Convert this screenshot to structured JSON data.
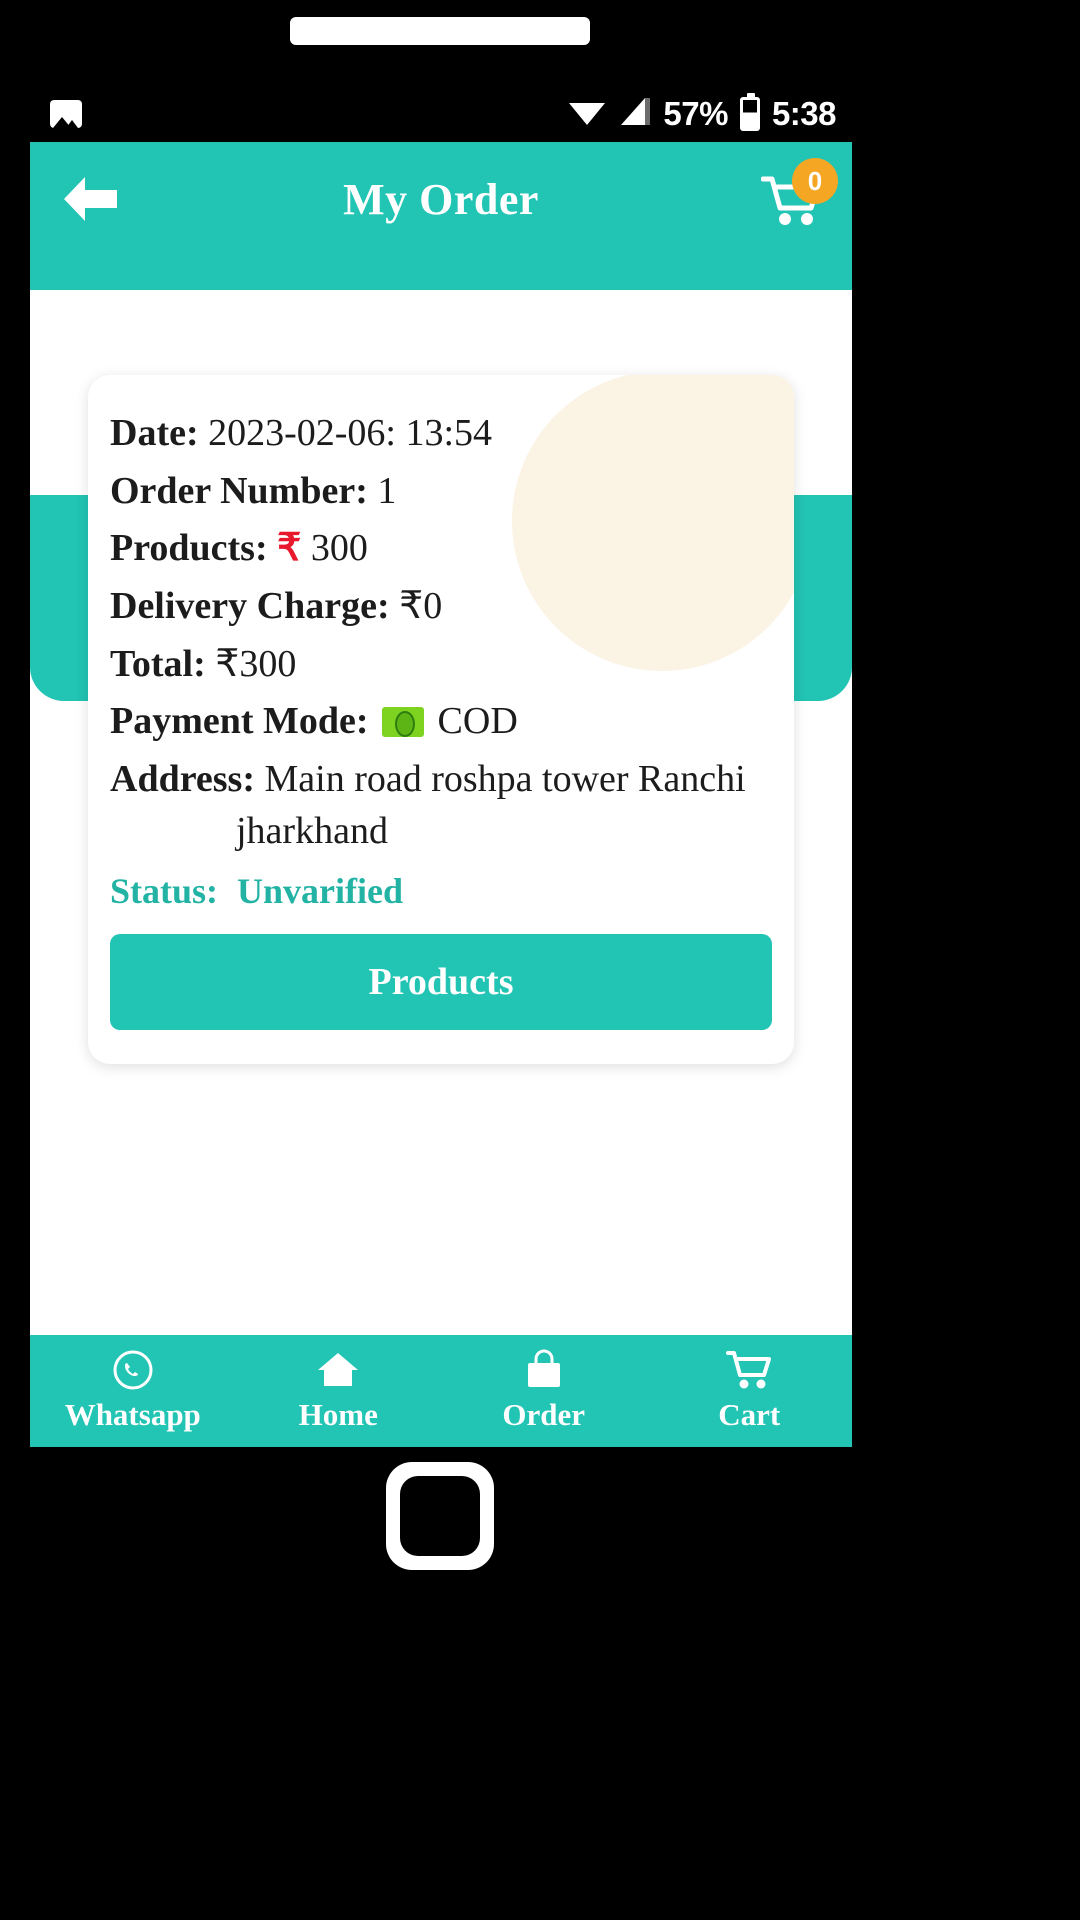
{
  "status_bar": {
    "photo_icon": "photo-icon",
    "wifi_icon": "wifi-icon",
    "signal_icon": "cellular-signal-icon",
    "battery_percent": "57%",
    "battery_icon": "battery-icon",
    "time": "5:38"
  },
  "app_bar": {
    "back_icon": "back-arrow-icon",
    "title": "My Order",
    "cart_icon": "shopping-cart-icon",
    "cart_badge_count": "0"
  },
  "order_card": {
    "rows": [
      {
        "label": "Date:",
        "value": "2023-02-06: 13:54"
      },
      {
        "label": "Order Number:",
        "value": "1"
      },
      {
        "label": "Products:",
        "currency": "₹",
        "value": "300"
      },
      {
        "label": "Delivery Charge:",
        "value": "₹0"
      },
      {
        "label": "Total:",
        "value": "₹300"
      },
      {
        "label": "Payment Mode:",
        "icon": "banknote-icon",
        "value": "COD"
      }
    ],
    "address": {
      "label": "Address:",
      "line1": "Main road roshpa tower Ranchi",
      "line2": "jharkhand"
    },
    "status": {
      "label": "Status:",
      "value": "Unvarified"
    },
    "products_button_label": "Products"
  },
  "bottom_nav": [
    {
      "icon": "whatsapp-icon",
      "label": "Whatsapp"
    },
    {
      "icon": "home-icon",
      "label": "Home"
    },
    {
      "icon": "shopping-bag-icon",
      "label": "Order"
    },
    {
      "icon": "shopping-cart-icon",
      "label": "Cart"
    }
  ],
  "colors": {
    "primary_teal": "#22c4b4",
    "status_teal": "#22b3a4",
    "badge_orange": "#f5a623",
    "rupee_red": "#e8192c",
    "blob_cream": "#fbf3e4",
    "money_green": "#7ed321"
  }
}
